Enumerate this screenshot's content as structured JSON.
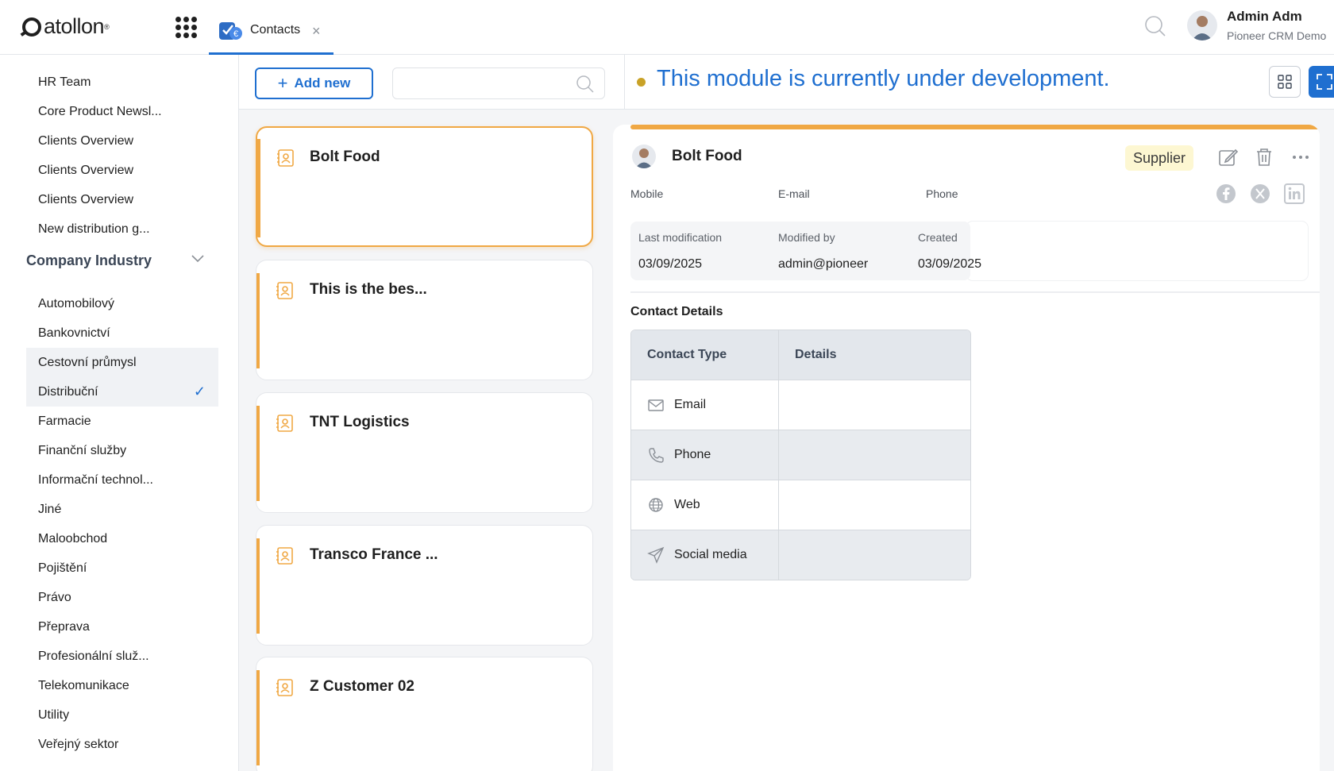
{
  "app": {
    "logo": "atollon"
  },
  "tab": {
    "label": "Contacts",
    "close": "×"
  },
  "user": {
    "name": "Admin Adm",
    "org": "Pioneer CRM Demo"
  },
  "sidebar": {
    "items_top": [
      "HR Team",
      "Core Product Newsl...",
      "Clients Overview",
      "Clients Overview",
      "Clients Overview",
      "New distribution g..."
    ],
    "group_title": "Company Industry",
    "industries": [
      "Automobilový",
      "Bankovnictví",
      "Cestovní průmysl",
      "Distribuční",
      "Farmacie",
      "Finanční služby",
      "Informační technol...",
      "Jiné",
      "Maloobchod",
      "Pojištění",
      "Právo",
      "Přeprava",
      "Profesionální služ...",
      "Telekomunikace",
      "Utility",
      "Veřejný sektor"
    ],
    "check": "✓"
  },
  "list": {
    "add_label": "Add new",
    "add_plus": "+",
    "search_placeholder": "",
    "cards": [
      "Bolt Food",
      "This is the bes...",
      "TNT Logistics",
      "Transco France ...",
      "Z Customer 02"
    ]
  },
  "banner": {
    "text": "This module is currently under development."
  },
  "detail": {
    "name": "Bolt Food",
    "badge": "Supplier",
    "labels": {
      "mobile": "Mobile",
      "email": "E-mail",
      "phone": "Phone"
    },
    "meta": {
      "last_mod_label": "Last modification",
      "modified_by_label": "Modified by",
      "created_label": "Created",
      "last_mod": "03/09/2025",
      "modified_by": "admin@pioneer",
      "created": "03/09/2025"
    },
    "section_title": "Contact Details",
    "table": {
      "headers": [
        "Contact Type",
        "Details"
      ],
      "rows": [
        {
          "type": "Email",
          "details": ""
        },
        {
          "type": "Phone",
          "details": ""
        },
        {
          "type": "Web",
          "details": ""
        },
        {
          "type": "Social media",
          "details": ""
        }
      ]
    }
  },
  "colors": {
    "accent": "#1f6fd0",
    "card_accent": "#f0a844",
    "badge_bg": "#fdf7d2"
  }
}
